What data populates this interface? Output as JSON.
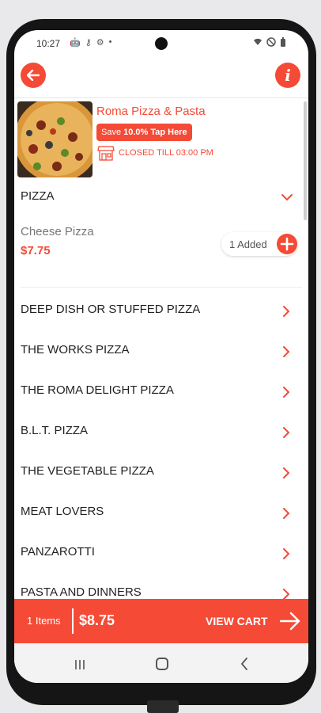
{
  "status_bar": {
    "time": "10:27",
    "left_icons": [
      "android-icon",
      "key-icon",
      "gear-icon",
      "dot-icon"
    ],
    "right_icons": [
      "wifi-icon",
      "dnd-icon",
      "battery-icon"
    ]
  },
  "colors": {
    "accent": "#f44a36",
    "text": "#222222",
    "muted": "#777777"
  },
  "restaurant": {
    "name": "Roma Pizza & Pasta",
    "save_prefix": "Save",
    "save_bold": "10.0% Tap Here",
    "status": "CLOSED TILL 03:00 PM"
  },
  "section": {
    "title": "PIZZA",
    "item": {
      "name": "Cheese Pizza",
      "price": "$7.75",
      "added_label": "1 Added"
    }
  },
  "categories": [
    {
      "label": "DEEP DISH OR STUFFED PIZZA"
    },
    {
      "label": "THE WORKS PIZZA"
    },
    {
      "label": "THE ROMA DELIGHT PIZZA"
    },
    {
      "label": "B.L.T. PIZZA"
    },
    {
      "label": "THE VEGETABLE PIZZA"
    },
    {
      "label": "MEAT LOVERS"
    },
    {
      "label": "PANZAROTTI"
    },
    {
      "label": "PASTA AND DINNERS"
    }
  ],
  "cart": {
    "items": "1 Items",
    "total": "$8.75",
    "view_label": "VIEW CART"
  }
}
